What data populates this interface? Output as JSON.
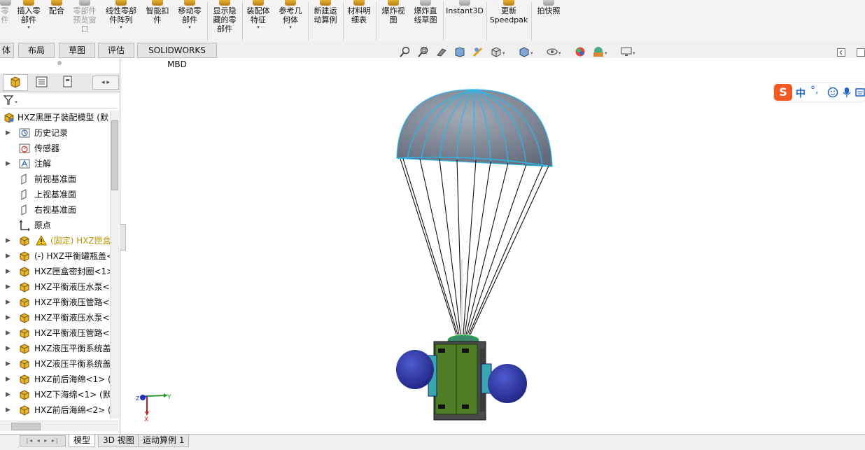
{
  "ribbon": {
    "items": [
      {
        "label": "零\n件",
        "disabled": true
      },
      {
        "label": "插入零\n部件",
        "dropdown": true
      },
      {
        "label": "配合"
      },
      {
        "label": "零部件\n预览窗\n口",
        "disabled": true
      },
      {
        "label": "线性零部\n件阵列",
        "dropdown": true
      },
      {
        "label": "智能扣\n件"
      },
      {
        "label": "移动零\n部件",
        "dropdown": true
      },
      {
        "label": "显示隐\n藏的零\n部件"
      },
      {
        "label": "装配体\n特征",
        "dropdown": true
      },
      {
        "label": "参考几\n何体",
        "dropdown": true
      },
      {
        "label": "新建运\n动算例"
      },
      {
        "label": "材料明\n细表"
      },
      {
        "label": "爆炸视\n图"
      },
      {
        "label": "爆炸直\n线草图"
      },
      {
        "label": "Instant3D"
      },
      {
        "label": "更新\nSpeedpak"
      },
      {
        "label": "拍快照"
      }
    ]
  },
  "command_tabs": [
    "体",
    "布局",
    "草图",
    "评估",
    "SOLIDWORKS MBD"
  ],
  "view_toolbar": {
    "icons": [
      "zoom-to-fit-icon",
      "zoom-area-icon",
      "previous-view-icon",
      "section-view-icon",
      "dynamic-annotation-icon",
      "view-orientation-icon",
      "display-style-icon",
      "hide-show-items-icon",
      "edit-appearance-icon",
      "apply-scene-icon",
      "view-settings-icon"
    ]
  },
  "feature_manager": {
    "tabs": [
      "featuremanager-tab",
      "propertymanager-tab",
      "configurationmanager-tab"
    ],
    "tree": [
      {
        "label": "HXZ黑匣子装配模型 (默",
        "icon": "assembly-icon",
        "arrow": false,
        "level": 0
      },
      {
        "label": "历史记录",
        "icon": "history-icon",
        "arrow": true,
        "level": 1
      },
      {
        "label": "传感器",
        "icon": "sensor-icon",
        "arrow": false,
        "level": 1
      },
      {
        "label": "注解",
        "icon": "annotation-icon",
        "arrow": true,
        "level": 1
      },
      {
        "label": "前视基准面",
        "icon": "plane-icon",
        "arrow": false,
        "level": 1
      },
      {
        "label": "上视基准面",
        "icon": "plane-icon",
        "arrow": false,
        "level": 1
      },
      {
        "label": "右视基准面",
        "icon": "plane-icon",
        "arrow": false,
        "level": 1
      },
      {
        "label": "原点",
        "icon": "origin-icon",
        "arrow": false,
        "level": 1
      },
      {
        "label": "(固定) HXZ匣盒",
        "icon": "part-icon",
        "arrow": true,
        "level": 1,
        "warning": true
      },
      {
        "label": "(-) HXZ平衡罐瓶盖<",
        "icon": "part-icon",
        "arrow": true,
        "level": 1
      },
      {
        "label": "HXZ匣盒密封圈<1>",
        "icon": "part-icon",
        "arrow": true,
        "level": 1
      },
      {
        "label": "HXZ平衡液压水泵<",
        "icon": "part-icon",
        "arrow": true,
        "level": 1
      },
      {
        "label": "HXZ平衡液压管路<",
        "icon": "part-icon",
        "arrow": true,
        "level": 1
      },
      {
        "label": "HXZ平衡液压水泵<",
        "icon": "part-icon",
        "arrow": true,
        "level": 1
      },
      {
        "label": "HXZ平衡液压管路<",
        "icon": "part-icon",
        "arrow": true,
        "level": 1
      },
      {
        "label": "HXZ液压平衡系统盖",
        "icon": "part-icon",
        "arrow": true,
        "level": 1
      },
      {
        "label": "HXZ液压平衡系统盖",
        "icon": "part-icon",
        "arrow": true,
        "level": 1
      },
      {
        "label": "HXZ前后海绵<1> (",
        "icon": "part-icon",
        "arrow": true,
        "level": 1
      },
      {
        "label": "HXZ下海绵<1> (默",
        "icon": "part-icon",
        "arrow": true,
        "level": 1
      },
      {
        "label": "HXZ前后海绵<2> (",
        "icon": "part-icon",
        "arrow": true,
        "level": 1
      }
    ]
  },
  "triad": {
    "x": "X",
    "y": "Y",
    "z": "Z"
  },
  "bottom_tabs": [
    "模型",
    "3D 视图",
    "运动算例 1"
  ],
  "active_bottom_tab": "模型",
  "ime_toolbar": {
    "logo": "S",
    "lang": "中",
    "punct": "°,"
  },
  "colors": {
    "canopy": "#7d8494",
    "seam": "#2bb7e8",
    "body": "#4e7d26",
    "ball": "#2f3aa6",
    "warning": "#c9a100"
  }
}
